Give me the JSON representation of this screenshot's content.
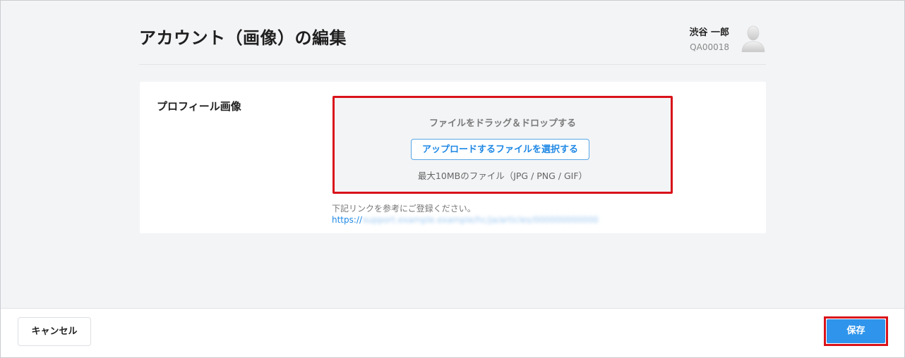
{
  "header": {
    "title": "アカウント（画像）の編集",
    "user": {
      "name": "渋谷 一郎",
      "id": "QA00018",
      "avatar_icon": "user-silhouette-icon"
    }
  },
  "form": {
    "profile_image_label": "プロフィール画像",
    "dropzone": {
      "text": "ファイルをドラッグ＆ドロップする",
      "upload_button_label": "アップロードするファイルを選択する",
      "note": "最大10MBのファイル（JPG / PNG / GIF）"
    },
    "help": {
      "text": "下記リンクを参考にご登録ください。",
      "link_prefix": "https://"
    }
  },
  "footer": {
    "cancel_label": "キャンセル",
    "save_label": "保存"
  },
  "colors": {
    "accent": "#2f95ec",
    "link": "#1e88e5",
    "highlight": "#d9131a",
    "background": "#f3f4f6"
  }
}
